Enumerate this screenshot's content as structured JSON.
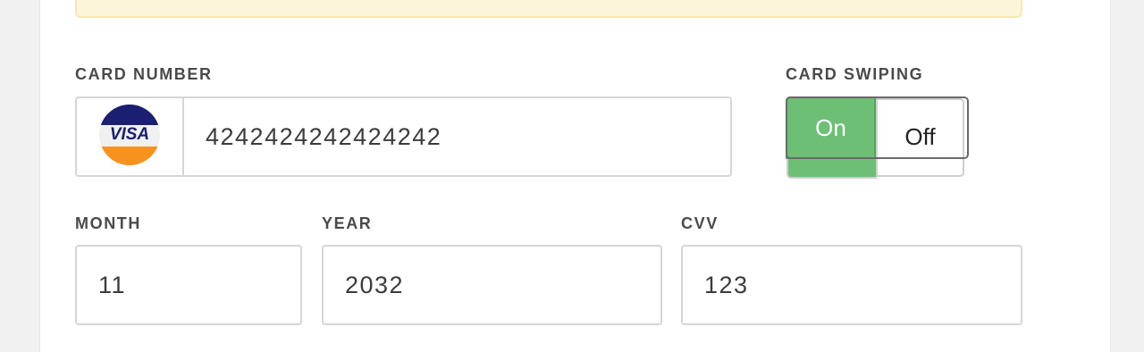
{
  "card_number": {
    "label": "CARD NUMBER",
    "value": "4242424242424242",
    "brand": "VISA",
    "brand_icon": "visa-card-icon",
    "brand_colors": {
      "top": "#1a1f71",
      "bottom": "#f7921e",
      "middle": "#f0f0f0"
    }
  },
  "card_swiping": {
    "label": "CARD SWIPING",
    "on_label": "On",
    "off_label": "Off",
    "selected": "On",
    "active_color": "#6dbf76"
  },
  "month": {
    "label": "MONTH",
    "value": "11"
  },
  "year": {
    "label": "YEAR",
    "value": "2032"
  },
  "cvv": {
    "label": "CVV",
    "value": "123"
  },
  "colors": {
    "alert_background": "#fdf5d9",
    "alert_border": "#f7e7b1",
    "label_text": "#4a4a4a",
    "field_border": "#d6d6d6"
  }
}
